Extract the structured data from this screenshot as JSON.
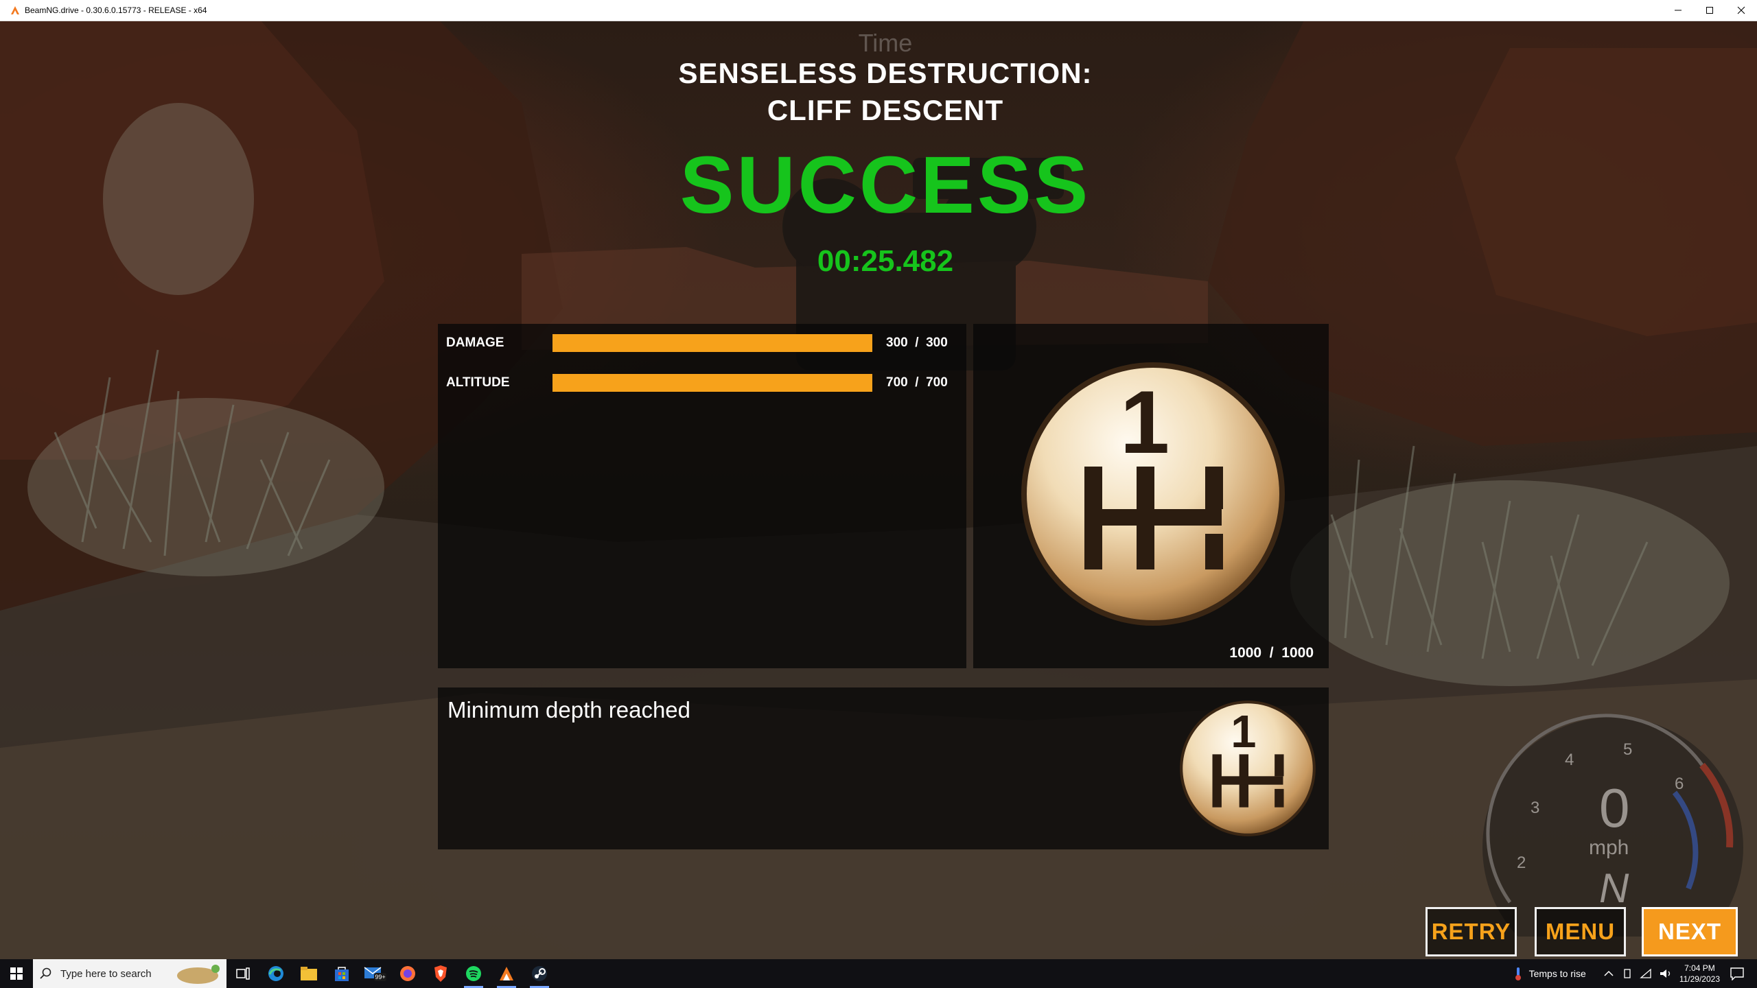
{
  "window": {
    "title": "BeamNG.drive - 0.30.6.0.15773 - RELEASE - x64"
  },
  "hud": {
    "time_label": "Time",
    "speed_unit": "mph",
    "speed_value": "0",
    "gear": "N",
    "gear_marks": [
      "2",
      "3",
      "4",
      "5",
      "6"
    ]
  },
  "mission": {
    "title_line1": "SENSELESS DESTRUCTION:",
    "title_line2": "CLIFF DESCENT",
    "result": "SUCCESS",
    "time": "00:25.482"
  },
  "stats": [
    {
      "label": "DAMAGE",
      "value_text": "300  /  300",
      "progress": 1.0
    },
    {
      "label": "ALTITUDE",
      "value_text": "700  /  700",
      "progress": 1.0
    }
  ],
  "medal": {
    "icon": "gear-shift-pattern-icon",
    "digit": "1",
    "score_text": "1000  /  1000"
  },
  "objective": {
    "text": "Minimum depth reached",
    "icon": "gear-shift-pattern-icon"
  },
  "buttons": {
    "retry": "RETRY",
    "menu": "MENU",
    "next": "NEXT"
  },
  "taskbar": {
    "search_placeholder": "Type here to search",
    "mail_badge": "99+",
    "weather_text": "Temps to rise",
    "time": "7:04 PM",
    "date": "11/29/2023"
  },
  "colors": {
    "success": "#16c41c",
    "accent": "#f7a21b",
    "panel": "rgba(8,8,8,0.78)"
  }
}
